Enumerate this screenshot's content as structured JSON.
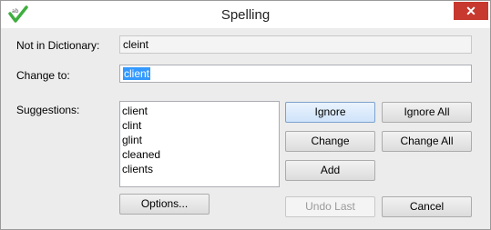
{
  "window": {
    "title": "Spelling",
    "close_glyph": "✕",
    "app_icon": "spellcheck-icon"
  },
  "not_in_dictionary": {
    "label": "Not in Dictionary:",
    "value": "cleint"
  },
  "change_to": {
    "label": "Change to:",
    "value": "client"
  },
  "suggestions": {
    "label": "Suggestions:",
    "items": [
      "client",
      "clint",
      "glint",
      "cleaned",
      "clients"
    ]
  },
  "buttons": {
    "ignore": "Ignore",
    "ignore_all": "Ignore All",
    "change": "Change",
    "change_all": "Change All",
    "add": "Add",
    "undo_last": "Undo Last",
    "cancel": "Cancel",
    "options": "Options..."
  },
  "colors": {
    "accent": "#3399ff",
    "close": "#c7392f",
    "icon_green": "#3fae3f"
  }
}
